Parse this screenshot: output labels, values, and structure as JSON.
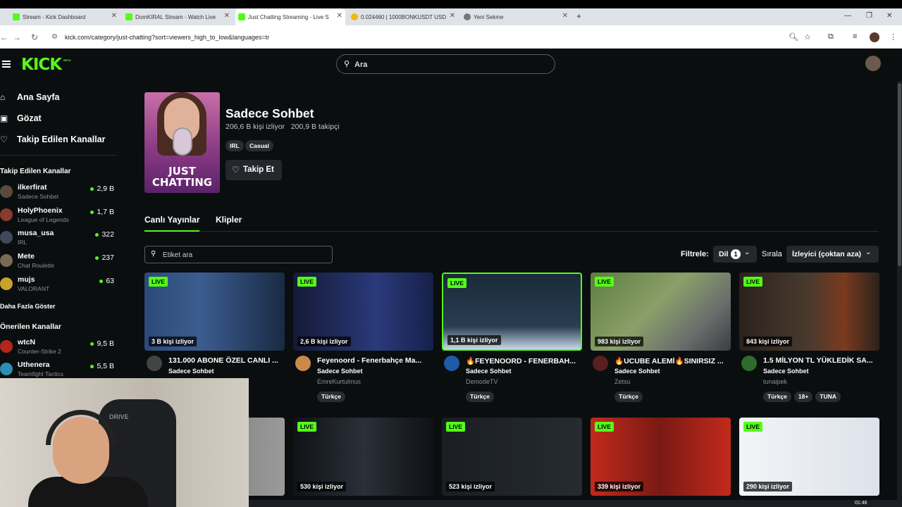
{
  "browser": {
    "tabs": [
      {
        "label": "Stream - Kick Dashboard",
        "favicon": "#53fc18",
        "active": false
      },
      {
        "label": "DomKIRAL Stream - Watch Live",
        "favicon": "#53fc18",
        "active": false
      },
      {
        "label": "Just Chatting Streaming - Live S",
        "favicon": "#53fc18",
        "active": true
      },
      {
        "label": "0.024460 | 1000BONKUSDT USD",
        "favicon": "#f0b90b",
        "active": false
      },
      {
        "label": "Yeni Sekme",
        "favicon": "#777777",
        "active": false
      }
    ],
    "url": "kick.com/category/just-chatting?sort=viewers_high_to_low&languages=tr"
  },
  "header": {
    "logo": "KICK",
    "beta": "BETA",
    "search_placeholder": "Ara"
  },
  "sidebar": {
    "nav": [
      {
        "label": "Ana Sayfa",
        "icon": "home-icon"
      },
      {
        "label": "Gözat",
        "icon": "browse-icon"
      },
      {
        "label": "Takip Edilen Kanallar",
        "icon": "heart-icon"
      }
    ],
    "followed_title": "Takip Edilen Kanallar",
    "followed": [
      {
        "name": "ilkerfirat",
        "category": "Sadece Sohbet",
        "viewers": "2,9 B",
        "avatar": "#5a4a3e"
      },
      {
        "name": "HolyPhoenix",
        "category": "League of Legends",
        "viewers": "1,7 B",
        "avatar": "#8a3b2e"
      },
      {
        "name": "musa_usa",
        "category": "IRL",
        "viewers": "322",
        "avatar": "#3e4a5a"
      },
      {
        "name": "Mete",
        "category": "Chat Roulette",
        "viewers": "237",
        "avatar": "#7a6a55"
      },
      {
        "name": "mujs",
        "category": "VALORANT",
        "viewers": "63",
        "avatar": "#c9a227"
      }
    ],
    "show_more": "Daha Fazla Göster",
    "recommended_title": "Önerilen Kanallar",
    "recommended": [
      {
        "name": "wtcN",
        "category": "Counter-Strike 2",
        "viewers": "9,5 B",
        "avatar": "#b3261e"
      },
      {
        "name": "Uthenera",
        "category": "Teamfight Tactics",
        "viewers": "5,5 B",
        "avatar": "#2a8fb3"
      }
    ]
  },
  "category": {
    "art_text_1": "JUST",
    "art_text_2": "CHATTING",
    "title": "Sadece Sohbet",
    "stats": "206,6 B kişi izliyor   200,9 B takipçi",
    "tags": [
      "IRL",
      "Casual"
    ],
    "follow_label": "Takip Et"
  },
  "tabs": [
    "Canlı Yayınlar",
    "Klipler"
  ],
  "filters": {
    "tag_search_placeholder": "Etiket ara",
    "filter_label": "Filtrele:",
    "language_label": "Dil",
    "language_count": "1",
    "sort_label": "Sırala",
    "sort_value": "İzleyici (çoktan aza)"
  },
  "live_badge": "LIVE",
  "streams_row1": [
    {
      "viewers": "3 B kişi izliyor",
      "title": "131.000 ABONE ÖZEL CANLI ...",
      "category": "Sadece Sohbet",
      "channel": "",
      "tags": [],
      "thumb": "#2b4a78",
      "avatar": "#444444"
    },
    {
      "viewers": "2,6 B kişi izliyor",
      "title": "Feyenoord - Fenerbahçe Ma...",
      "category": "Sadece Sohbet",
      "channel": "EmreKurtulmus",
      "tags": [
        "Türkçe"
      ],
      "thumb": "#1b2440",
      "avatar": "#c98a4a"
    },
    {
      "viewers": "1,1 B kişi izliyor",
      "title": "🔥FEYENOORD - FENERBAH...",
      "category": "Sadece Sohbet",
      "channel": "DemodeTV",
      "tags": [
        "Türkçe"
      ],
      "thumb": "#1a2a38",
      "avatar": "#1e5aa8"
    },
    {
      "viewers": "983 kişi izliyor",
      "title": "🔥UCUBE ALEMİ🔥SINIRSIZ ...",
      "category": "Sadece Sohbet",
      "channel": "Zetsu",
      "tags": [
        "Türkçe"
      ],
      "thumb": "#4f6b3a",
      "avatar": "#5a1f1f"
    },
    {
      "viewers": "843 kişi izliyor",
      "title": "1.5 MİLYON TL YÜKLEDİK SA...",
      "category": "Sadece Sohbet",
      "channel": "tunaipek",
      "tags": [
        "Türkçe",
        "18+",
        "TUNA"
      ],
      "thumb": "#3a2e26",
      "avatar": "#2e6b2e"
    }
  ],
  "streams_row2": [
    {
      "viewers": "",
      "thumb": "#8a8a8a",
      "live": false
    },
    {
      "viewers": "530 kişi izliyor",
      "thumb": "#15191f",
      "live": true
    },
    {
      "viewers": "523 kişi izliyor",
      "thumb": "#1d2125",
      "live": true
    },
    {
      "viewers": "339 kişi izliyor",
      "thumb": "#a0261b",
      "live": true
    },
    {
      "viewers": "290 kişi izliyor",
      "thumb": "#e8ebf0",
      "live": true
    }
  ],
  "webcam": {
    "chair_brand": "DRIVE"
  },
  "clock": "01:46"
}
